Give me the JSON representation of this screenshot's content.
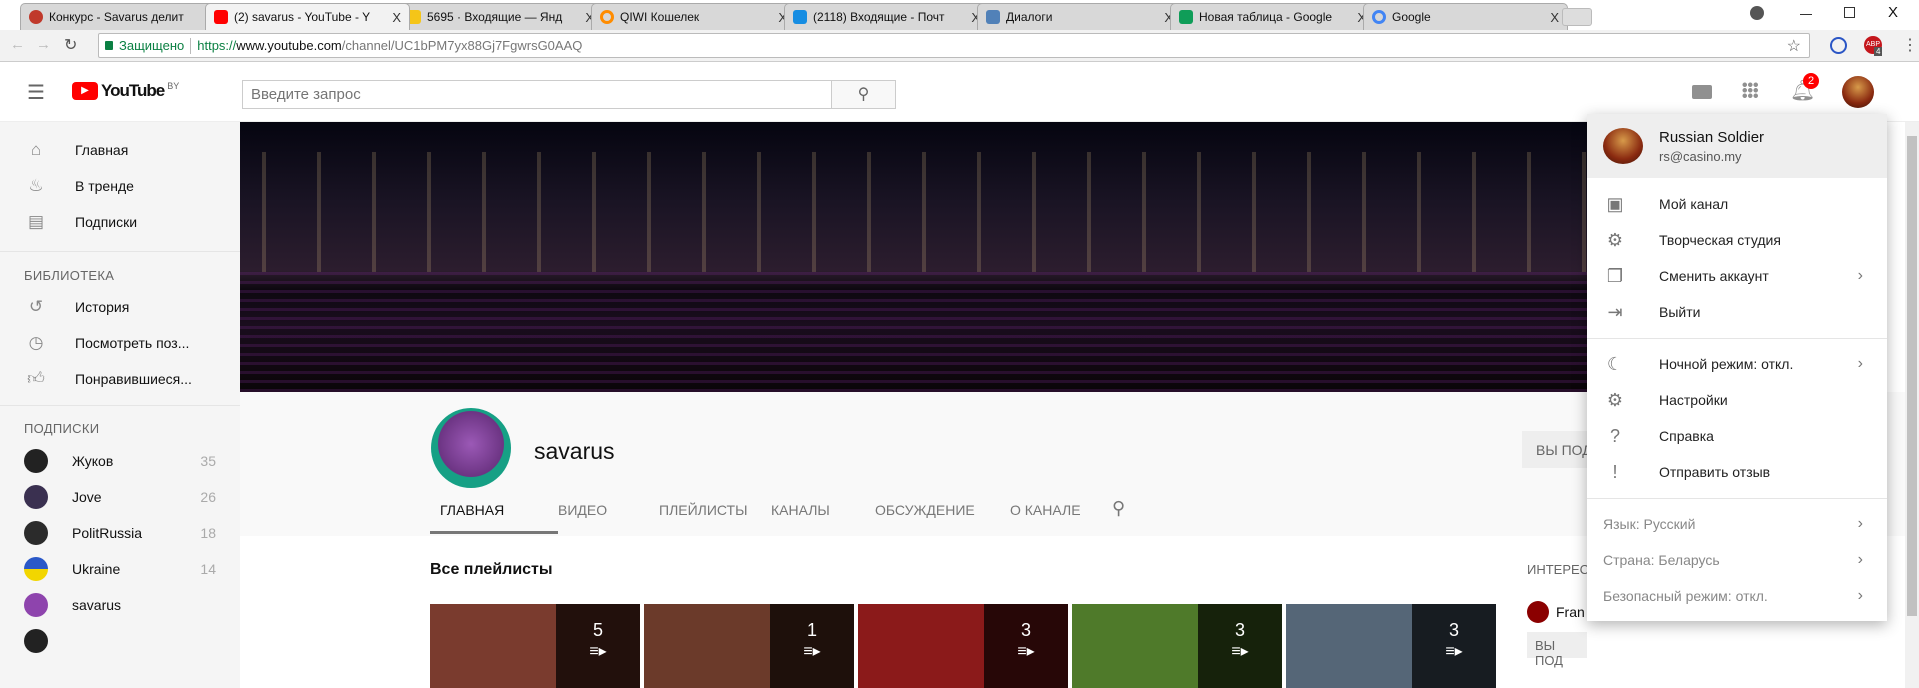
{
  "browser": {
    "tabs": [
      {
        "title": "Конкурс - Savarus делит",
        "color": "#c0392b"
      },
      {
        "title": "(2) savarus - YouTube - Y",
        "color": "#ff0000"
      },
      {
        "title": "5695 · Входящие — Янд",
        "color": "#f5c518"
      },
      {
        "title": "QIWI Кошелек",
        "color": "#ff8c00"
      },
      {
        "title": "(2118) Входящие - Почт",
        "color": "#168de2"
      },
      {
        "title": "Диалоги",
        "color": "#5181b8"
      },
      {
        "title": "Новая таблица - Google",
        "color": "#0f9d58"
      },
      {
        "title": "Google",
        "color": "#4285f4"
      }
    ],
    "active_tab": 1,
    "secure_label": "Защищено",
    "url_scheme": "https://",
    "url_host": "www.youtube.com",
    "url_path": "/channel/UC1bPM7yx88Gj7FgwrsG0AAQ",
    "abp_badge": "4",
    "close": "X"
  },
  "youtube": {
    "logo": "YouTube",
    "logo_region": "BY",
    "search_placeholder": "Введите запрос",
    "notif_count": "2",
    "sidebar": {
      "main": [
        {
          "label": "Главная",
          "icon": "home"
        },
        {
          "label": "В тренде",
          "icon": "flame"
        },
        {
          "label": "Подписки",
          "icon": "subscriptions"
        }
      ],
      "library_title": "БИБЛИОТЕКА",
      "library": [
        {
          "label": "История",
          "icon": "history"
        },
        {
          "label": "Посмотреть поз...",
          "icon": "clock"
        },
        {
          "label": "Понравившиеся...",
          "icon": "thumb-up"
        }
      ],
      "subs_title": "ПОДПИСКИ",
      "subs": [
        {
          "name": "Жуков",
          "count": "35",
          "color": "#222"
        },
        {
          "name": "Jove",
          "count": "26",
          "color": "#3a3050"
        },
        {
          "name": "PolitRussia",
          "count": "18",
          "color": "#2b2b2b"
        },
        {
          "name": "Ukraine",
          "count": "14",
          "color": "#2a58c8"
        },
        {
          "name": "savarus",
          "count": "",
          "color": "#8e44ad"
        }
      ]
    },
    "channel": {
      "name": "savarus",
      "tabs": [
        "ГЛАВНАЯ",
        "ВИДЕО",
        "ПЛЕЙЛИСТЫ",
        "КАНАЛЫ",
        "ОБСУЖДЕНИЕ",
        "О КАНАЛЕ"
      ],
      "subscribed_button": "ВЫ ПОД",
      "section_title": "Все плейлисты",
      "playlists": [
        {
          "count": "5",
          "color": "#7a3b2e"
        },
        {
          "count": "1",
          "color": "#6b3a2a"
        },
        {
          "count": "3",
          "color": "#8b1a1a"
        },
        {
          "count": "3",
          "color": "#4f7a2a"
        },
        {
          "count": "3",
          "color": "#556677"
        }
      ],
      "right_title": "ИНТЕРЕС",
      "right_channel": "Fran",
      "right_button": "ВЫ ПОД"
    },
    "account_menu": {
      "name": "Russian Soldier",
      "email": "rs@casino.my",
      "group1": [
        {
          "label": "Мой канал",
          "icon": "account-box"
        },
        {
          "label": "Творческая студия",
          "icon": "gear"
        },
        {
          "label": "Сменить аккаунт",
          "icon": "switch-account",
          "chevron": true
        },
        {
          "label": "Выйти",
          "icon": "logout"
        }
      ],
      "group2": [
        {
          "label": "Ночной режим: откл.",
          "icon": "moon",
          "chevron": true
        },
        {
          "label": "Настройки",
          "icon": "gear"
        },
        {
          "label": "Справка",
          "icon": "help"
        },
        {
          "label": "Отправить отзыв",
          "icon": "feedback"
        }
      ],
      "footer": [
        {
          "label": "Язык: Русский"
        },
        {
          "label": "Страна: Беларусь"
        },
        {
          "label": "Безопасный режим: откл."
        }
      ]
    }
  }
}
